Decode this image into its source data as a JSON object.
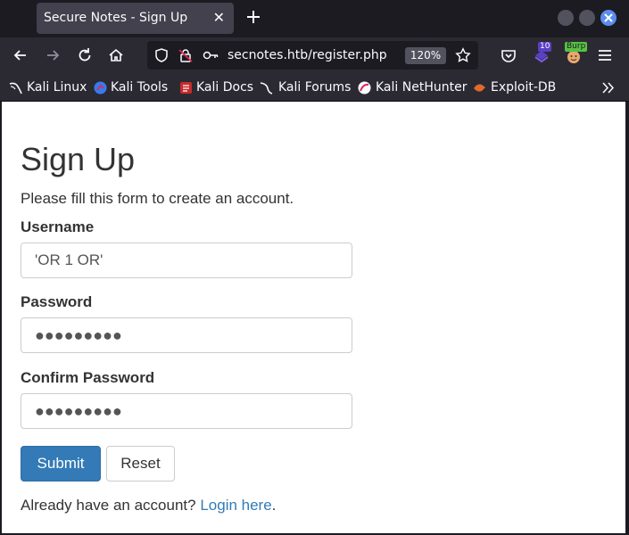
{
  "tab": {
    "title": "Secure Notes - Sign Up",
    "close_glyph": "✕"
  },
  "new_tab_icon": "plus-icon",
  "nav": {
    "url": "secnotes.htb/register.php",
    "zoom": "120%",
    "extension_badge_1": "10",
    "extension_badge_2": "Burp"
  },
  "bookmarks": [
    {
      "label": "Kali Linux",
      "icon": "kali-dragon-icon"
    },
    {
      "label": "Kali Tools",
      "icon": "kali-tools-icon"
    },
    {
      "label": "Kali Docs",
      "icon": "kali-docs-icon"
    },
    {
      "label": "Kali Forums",
      "icon": "kali-forums-icon"
    },
    {
      "label": "Kali NetHunter",
      "icon": "nethunter-icon"
    },
    {
      "label": "Exploit-DB",
      "icon": "exploit-db-icon"
    }
  ],
  "bookmarks_overflow_icon": "chevron-double-right-icon",
  "form": {
    "title": "Sign Up",
    "subtitle": "Please fill this form to create an account.",
    "username_label": "Username",
    "username_value": "'OR 1 OR'",
    "password_label": "Password",
    "password_value": "●●●●●●●●●",
    "confirm_label": "Confirm Password",
    "confirm_value": "●●●●●●●●●",
    "submit_label": "Submit",
    "reset_label": "Reset",
    "login_prompt": "Already have an account?",
    "login_link": "Login here",
    "login_suffix": "."
  },
  "colors": {
    "primary": "#337ab7",
    "chrome_dark": "#1c1b22",
    "chrome_toolbar": "#2b2a33",
    "text": "#333333"
  }
}
